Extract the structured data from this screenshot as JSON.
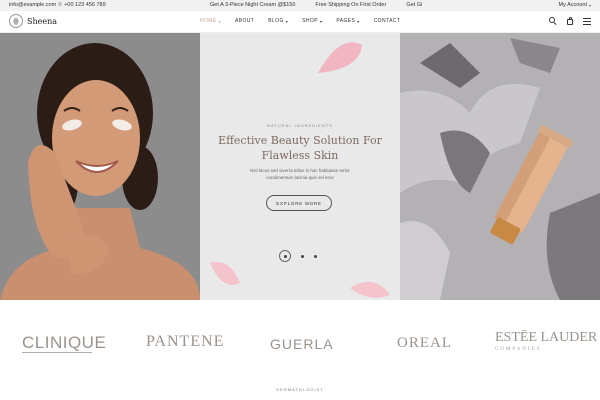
{
  "topbar": {
    "email": "info@example.com",
    "phone": "+00 123 456 789",
    "ticker": [
      "Get A 3-Piece Night Cream @$150",
      "Free Shipping On First Order",
      "Get Gi"
    ],
    "account": "My Account"
  },
  "header": {
    "logo_text": "Sheena",
    "nav": [
      {
        "label": "HOME",
        "has_dropdown": true,
        "active": true
      },
      {
        "label": "ABOUT",
        "has_dropdown": false,
        "active": false
      },
      {
        "label": "BLOG",
        "has_dropdown": true,
        "active": false
      },
      {
        "label": "SHOP",
        "has_dropdown": true,
        "active": false
      },
      {
        "label": "PAGES",
        "has_dropdown": true,
        "active": false
      },
      {
        "label": "CONTACT",
        "has_dropdown": false,
        "active": false
      }
    ],
    "icons": [
      "search-icon",
      "bag-icon",
      "menu-icon"
    ]
  },
  "hero": {
    "kicker": "NATURAL INGREDIENTS",
    "headline_line1": "Effective Beauty Solution For",
    "headline_line2": "Flawless Skin",
    "subtext_line1": "Nisl lacus sed viverra tellus in hac habitasse tortor",
    "subtext_line2": "condimentum lacinia quis vel eros",
    "cta_label": "EXPLORE MORE",
    "slides_total": 3,
    "slide_active": 1
  },
  "brands": {
    "items": [
      "CLINIQUE",
      "PANTENE",
      "GUERLA",
      "OREAL",
      "ESTĒE LAUDER"
    ],
    "estee_sub": "COMPANIES",
    "section_label": "DERMATOLOGIST"
  },
  "colors": {
    "accent": "#c9a89a",
    "headline": "#7d6a5f",
    "topbar_bg": "#f1f1f1",
    "mid_panel_bg": "#e9e9e9",
    "brand_logo": "#9b938c"
  }
}
